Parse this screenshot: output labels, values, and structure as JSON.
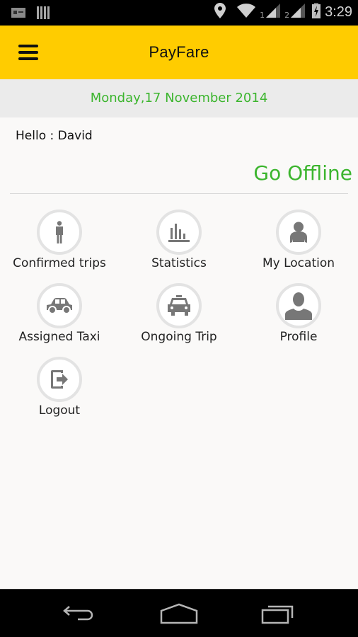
{
  "status_bar": {
    "time": "3:29",
    "sim1_label": "1",
    "sim2_label": "2",
    "icons": [
      "notification-icon",
      "barcode-icon",
      "location-icon",
      "wifi-icon",
      "signal-icon",
      "signal-icon",
      "battery-charging-icon"
    ]
  },
  "app_bar": {
    "title": "PayFare",
    "menu_icon": "hamburger-menu-icon"
  },
  "date_bar": {
    "date": "Monday,17 November 2014"
  },
  "greeting": "Hello : David",
  "status_toggle": "Go Offline",
  "menu": [
    {
      "label": "Confirmed trips",
      "icon": "person-icon"
    },
    {
      "label": "Statistics",
      "icon": "bar-chart-icon"
    },
    {
      "label": "My Location",
      "icon": "user-location-icon"
    },
    {
      "label": "Assigned Taxi",
      "icon": "car-icon"
    },
    {
      "label": "Ongoing Trip",
      "icon": "taxi-icon"
    },
    {
      "label": "Profile",
      "icon": "profile-icon"
    },
    {
      "label": "Logout",
      "icon": "logout-icon"
    }
  ],
  "nav_bar": {
    "back": "back-icon",
    "home": "home-icon",
    "recents": "recent-apps-icon"
  },
  "colors": {
    "accent": "#ffcc00",
    "green": "#3cb52e",
    "icon_gray": "#777777"
  }
}
